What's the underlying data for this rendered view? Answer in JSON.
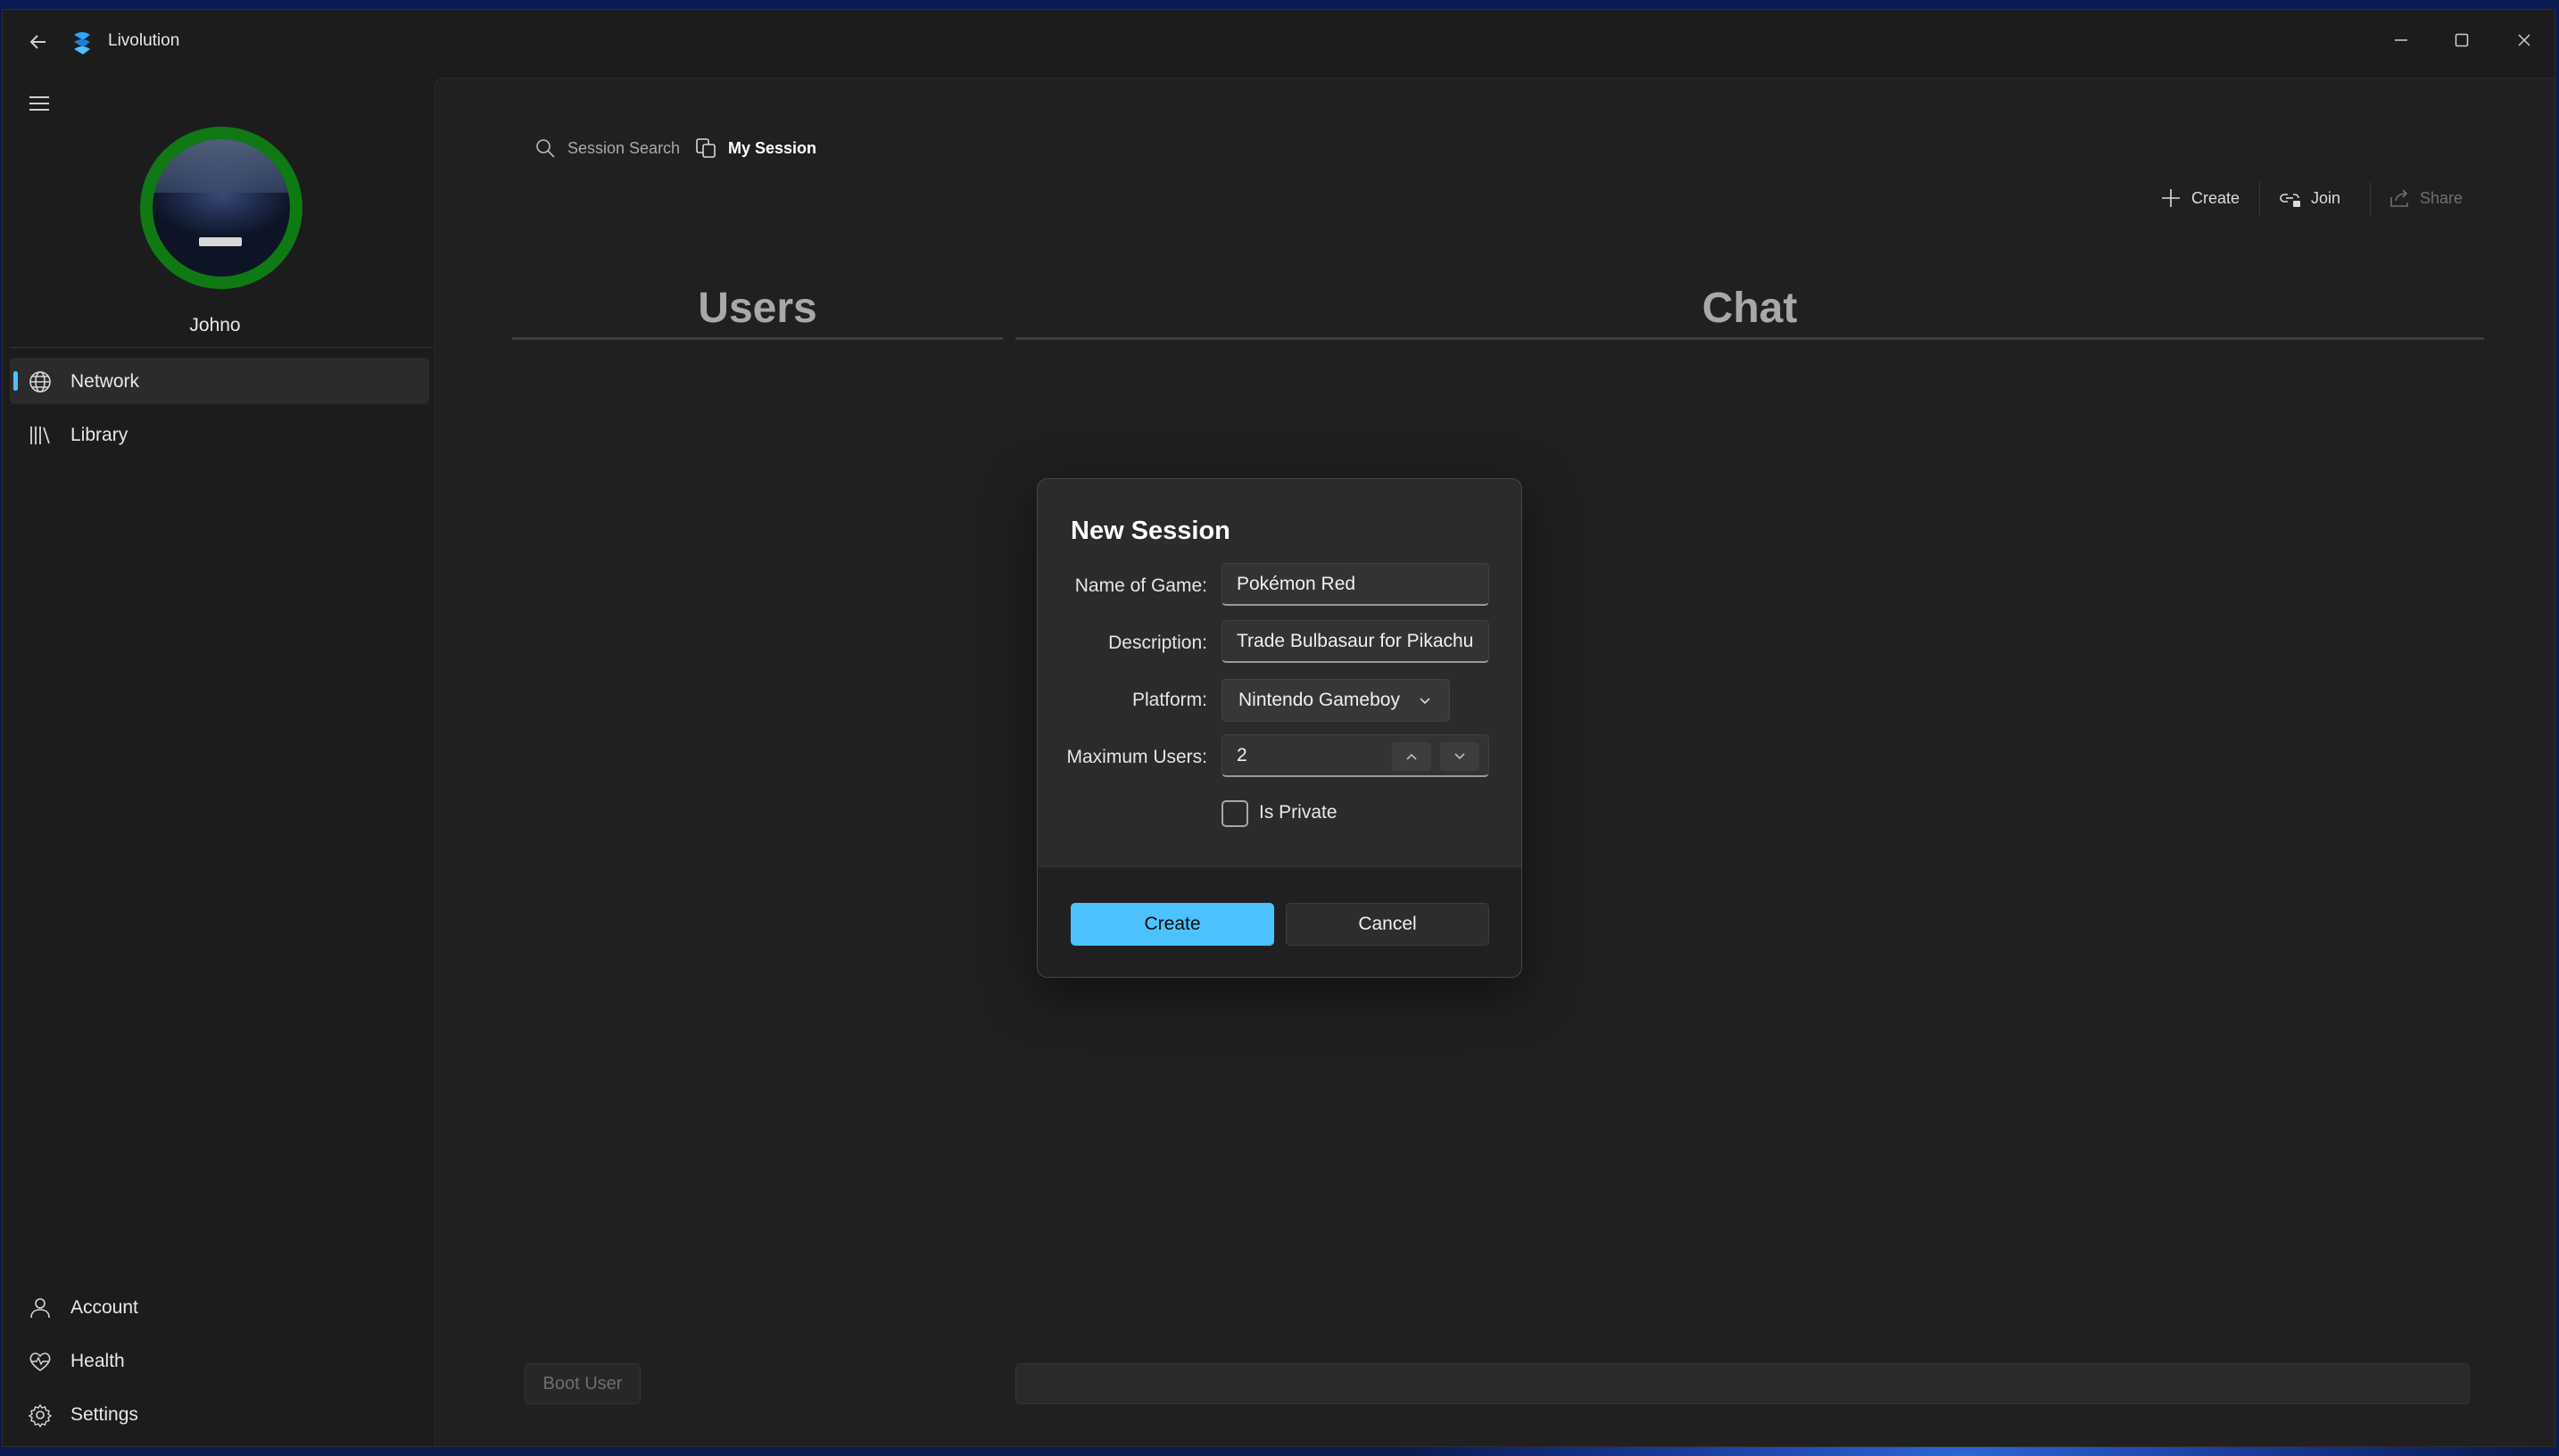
{
  "window": {
    "title": "Livolution"
  },
  "nav": {
    "username": "Johno",
    "items": [
      {
        "label": "Network",
        "icon": "globe-icon",
        "active": true
      },
      {
        "label": "Library",
        "icon": "library-icon",
        "active": false
      }
    ],
    "footer_items": [
      {
        "label": "Account",
        "icon": "person-icon"
      },
      {
        "label": "Health",
        "icon": "heart-pulse-icon"
      },
      {
        "label": "Settings",
        "icon": "gear-icon"
      }
    ]
  },
  "tabs": [
    {
      "label": "Session Search",
      "icon": "search-icon",
      "selected": false
    },
    {
      "label": "My Session",
      "icon": "session-icon",
      "selected": true
    }
  ],
  "commands": {
    "create": "Create",
    "join": "Join",
    "share": "Share"
  },
  "columns": {
    "users": "Users",
    "chat": "Chat"
  },
  "footer": {
    "boot_user": "Boot User"
  },
  "dialog": {
    "title": "New Session",
    "name_label": "Name of Game:",
    "name_value": "Pokémon Red",
    "description_label": "Description:",
    "description_value": "Trade Bulbasaur for Pikachu",
    "platform_label": "Platform:",
    "platform_value": "Nintendo Gameboy",
    "max_users_label": "Maximum Users:",
    "max_users_value": "2",
    "private_label": "Is Private",
    "private_checked": false,
    "create_label": "Create",
    "cancel_label": "Cancel"
  },
  "colors": {
    "accent": "#4cc2ff",
    "avatar_ring": "#0f7a14",
    "window_bg": "#1c1c1c",
    "content_bg": "#202020"
  }
}
